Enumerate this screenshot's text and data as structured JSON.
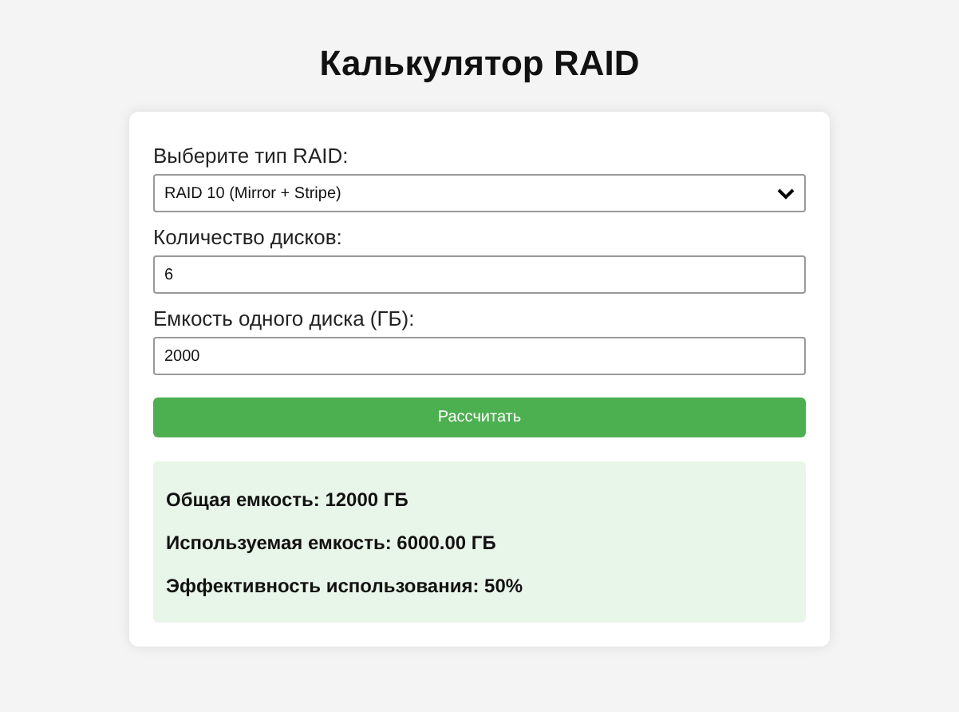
{
  "title": "Калькулятор RAID",
  "fields": [
    {
      "kind": "select",
      "label": "Выберите тип RAID:",
      "value": "RAID 10 (Mirror + Stripe)"
    },
    {
      "kind": "input",
      "label": "Количество дисков:",
      "value": "6"
    },
    {
      "kind": "input",
      "label": "Емкость одного диска (ГБ):",
      "value": "2000"
    }
  ],
  "button": "Рассчитать",
  "results": [
    "Общая емкость: 12000 ГБ",
    "Используемая емкость: 6000.00 ГБ",
    "Эффективность использования: 50%"
  ]
}
